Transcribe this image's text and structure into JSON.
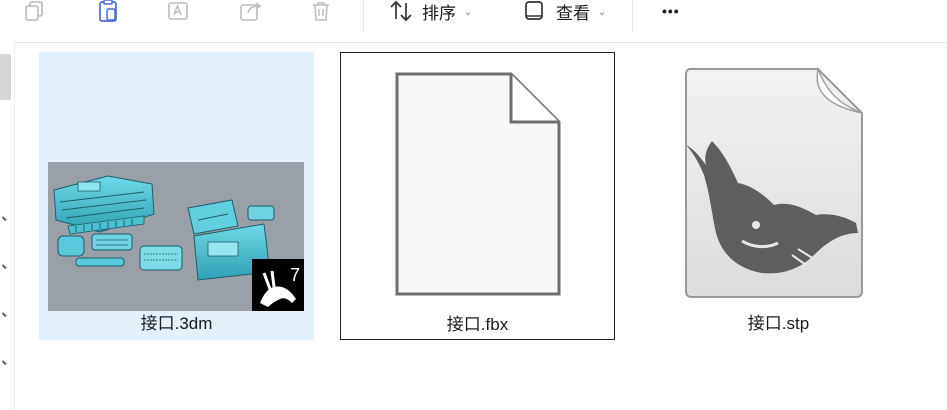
{
  "toolbar": {
    "sort_label": "排序",
    "view_label": "查看",
    "more_label": "•••"
  },
  "files": [
    {
      "name": "接口.3dm",
      "thumbnail": "rhino-3d-model-preview",
      "badge": "7",
      "state": "selected"
    },
    {
      "name": "接口.fbx",
      "thumbnail": "generic-document-icon",
      "state": "focused"
    },
    {
      "name": "接口.stp",
      "thumbnail": "rhino-stp-file-icon",
      "state": "normal"
    }
  ],
  "colors": {
    "selection": "#e3f1fd",
    "focus_border": "#222222",
    "model_teal": "#4fc3d6",
    "viewport_gray": "#9aa0a8"
  }
}
